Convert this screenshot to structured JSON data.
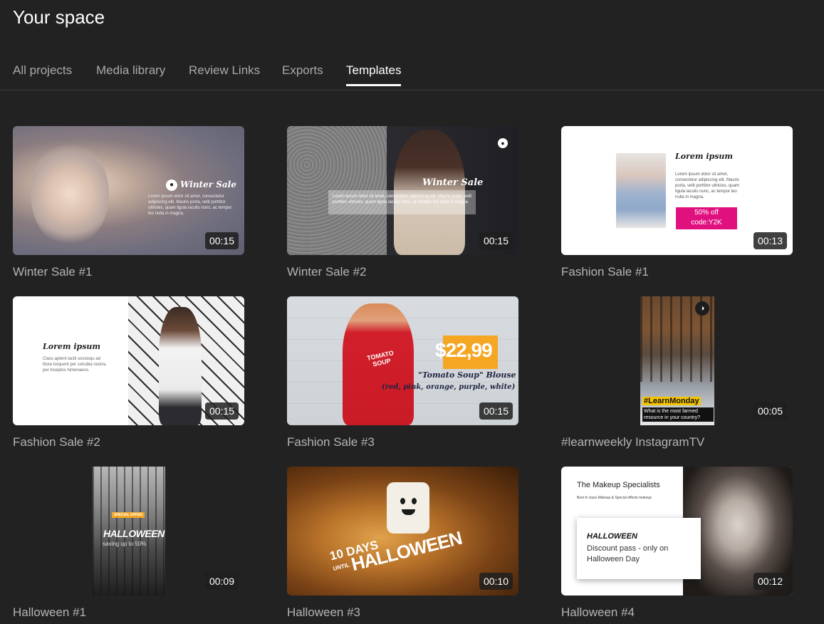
{
  "header": {
    "title": "Your space"
  },
  "tabs": [
    {
      "label": "All projects"
    },
    {
      "label": "Media library"
    },
    {
      "label": "Review Links"
    },
    {
      "label": "Exports"
    },
    {
      "label": "Templates"
    }
  ],
  "active_tab": "Templates",
  "templates": [
    {
      "title": "Winter Sale #1",
      "duration": "00:15",
      "overlay": {
        "heading": "Winter Sale",
        "body": "Lorem ipsum dolor sit amet, consectetur adipiscing elit. Mauris porta, velit porttitor ultricies, quam ligula iaculis nunc, ac tempor leo nulla in magna."
      }
    },
    {
      "title": "Winter Sale #2",
      "duration": "00:15",
      "overlay": {
        "heading": "Winter Sale",
        "body": "Lorem ipsum dolor sit amet, consectetur adipiscing elit. Mauris porta, velit porttitor ultricies, quam ligula iaculis nunc, ac tempor leo nulla in magna."
      }
    },
    {
      "title": "Fashion Sale #1",
      "duration": "00:13",
      "overlay": {
        "heading": "Lorem ipsum",
        "body": "Lorem ipsum dolor sit amet, consectetur adipiscing elit. Mauris porta, velit porttitor ultricies, quam ligula iaculis nunc, ac tempor leo nulla in magna.",
        "promo_line1": "50% off",
        "promo_line2": "code:Y2K"
      }
    },
    {
      "title": "Fashion Sale #2",
      "duration": "00:15",
      "overlay": {
        "heading": "Lorem ipsum",
        "body": "Class aptent taciti sociosqu ad litora torquent per conubia nostra, per inceptos himenaeos."
      }
    },
    {
      "title": "Fashion Sale #3",
      "duration": "00:15",
      "overlay": {
        "price": "$22,99",
        "product": "\"Tomato Soup\" Blouse",
        "colors": "(red, pink, orange, purple, white)",
        "shirt_line1": "TOMATO",
        "shirt_line2": "SOUP"
      }
    },
    {
      "title": "#learnweekly InstagramTV",
      "duration": "00:05",
      "overlay": {
        "hashtag": "#LearnMonday",
        "question": "What is the most farmed resource in your country?"
      }
    },
    {
      "title": "Halloween #1",
      "duration": "00:09",
      "overlay": {
        "tag": "SPECIAL OFFER",
        "heading": "HALLOWEEN",
        "sub": "saving up to 50%"
      }
    },
    {
      "title": "Halloween #3",
      "duration": "00:10",
      "overlay": {
        "line1": "10 DAYS",
        "line2": "UNTIL",
        "line3": "HALLOWEEN"
      }
    },
    {
      "title": "Halloween #4",
      "duration": "00:12",
      "overlay": {
        "brand": "The Makeup Specialists",
        "tagline": "Best in class Makeup & Special effects makeup",
        "heading": "HALLOWEEN",
        "body": "Discount pass - only on Halloween Day"
      }
    }
  ]
}
